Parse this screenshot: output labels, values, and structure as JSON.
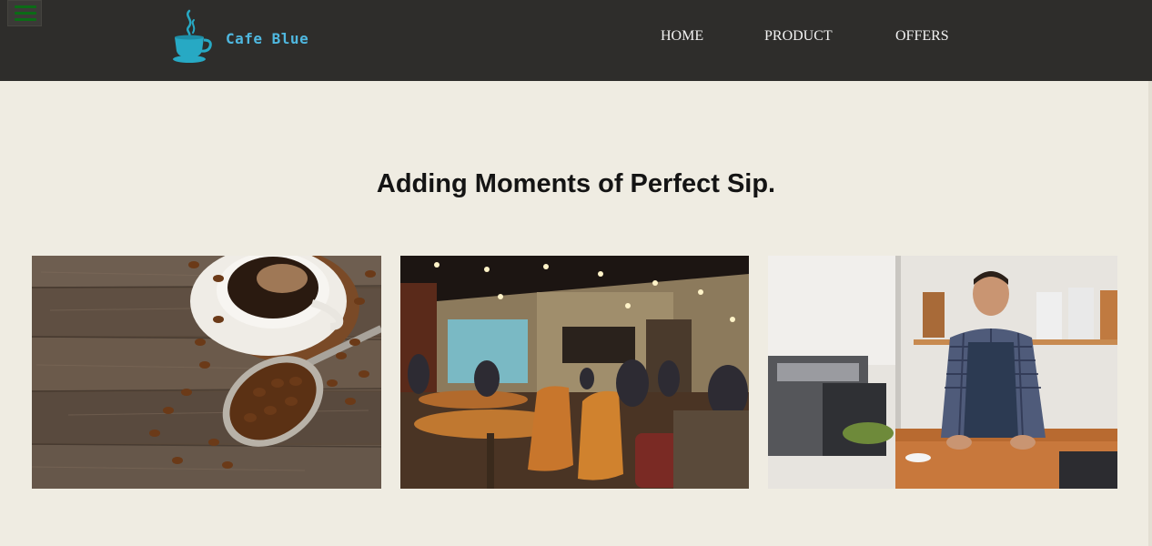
{
  "nav": {
    "brand": "Cafe Blue",
    "links": [
      "HOME",
      "PRODUCT",
      "OFFERS"
    ],
    "menu_icon": "hamburger-icon",
    "logo_icon": "coffee-cup-icon"
  },
  "hero": {
    "heading": "Adding Moments of Perfect Sip."
  },
  "gallery": {
    "images": [
      "coffee-beans-photo",
      "cafe-interior-photo",
      "barista-photo"
    ]
  },
  "colors": {
    "navbar_bg": "#2e2d2b",
    "page_bg": "#efece2",
    "brand_accent": "#4fb8e0",
    "logo_teal": "#27a9c4",
    "menu_icon_green": "#0b6b16"
  }
}
